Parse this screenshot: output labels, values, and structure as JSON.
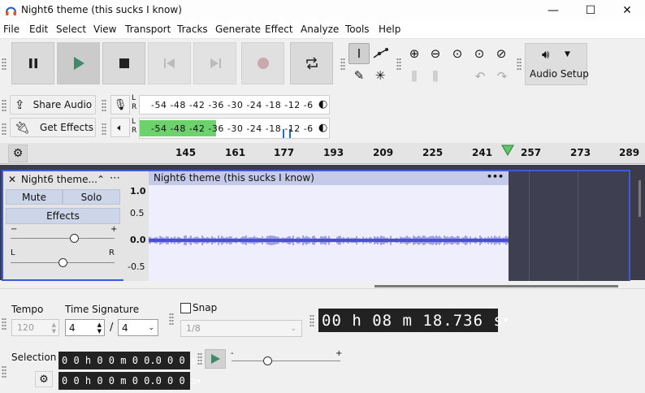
{
  "window": {
    "title": "Night6 theme (this sucks I know)",
    "minimize": "—",
    "maximize": "☐",
    "close": "✕"
  },
  "menu": [
    "File",
    "Edit",
    "Select",
    "View",
    "Transport",
    "Tracks",
    "Generate",
    "Effect",
    "Analyze",
    "Tools",
    "Help"
  ],
  "audio_setup": {
    "label": "Audio Setup"
  },
  "share": {
    "share_audio": "Share Audio",
    "get_effects": "Get Effects"
  },
  "meters": {
    "rec": {
      "lr": "L\nR",
      "scale": "-54 -48 -42 -36 -30 -24 -18 -12 -6"
    },
    "play": {
      "lr": "L\nR",
      "scale": "-54 -48 -42 -36 -30 -24 -18 -12 -6"
    }
  },
  "ruler": {
    "ticks": [
      "145",
      "161",
      "177",
      "193",
      "209",
      "225",
      "241",
      "257",
      "273",
      "289"
    ]
  },
  "track": {
    "name": "Night6 theme...",
    "mute": "Mute",
    "solo": "Solo",
    "effects": "Effects",
    "gain_minus": "−",
    "gain_plus": "+",
    "pan_left": "L",
    "pan_right": "R",
    "clip_title": "Night6 theme (this sucks I know)",
    "clip_menu": "•••",
    "close": "✕",
    "collapse": "⌃",
    "menu": "⋯",
    "axis": [
      "1.0",
      "0.5",
      "0.0",
      "-0.5"
    ]
  },
  "bottom": {
    "tempo_label": "Tempo",
    "tempo_value": "120",
    "timesig_label": "Time Signature",
    "timesig_num": "4",
    "timesig_sep": "/",
    "timesig_den": "4",
    "snap_label": "Snap",
    "snap_value": "1/8",
    "big_time": "00 h 08 m 18.736 s",
    "selection_label": "Selection",
    "sel_start": "0 0 h 0 0 m 0 0.0 0 0 s",
    "sel_end": "0 0 h 0 0 m 0 0.0 0 0 s",
    "speed_minus": "-",
    "speed_plus": "+"
  }
}
